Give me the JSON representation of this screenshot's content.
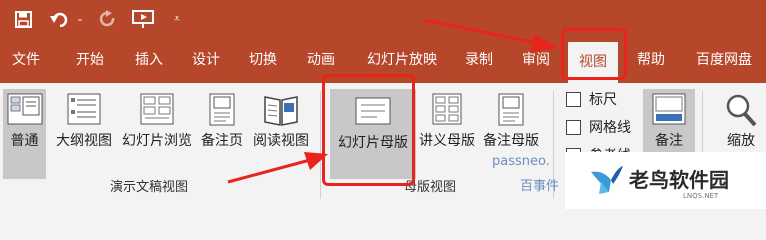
{
  "tabs": [
    "文件",
    "开始",
    "插入",
    "设计",
    "切换",
    "动画",
    "幻灯片放映",
    "录制",
    "审阅",
    "视图",
    "帮助",
    "百度网盘"
  ],
  "active_tab": "视图",
  "ribbon": {
    "presentation_views": [
      "普通",
      "大纲视图",
      "幻灯片浏览",
      "备注页",
      "阅读视图"
    ],
    "presentation_views_group": "演示文稿视图",
    "master_views": [
      "幻灯片母版",
      "讲义母版",
      "备注母版"
    ],
    "master_views_group": "母版视图",
    "show_options": [
      "标尺",
      "网格线",
      "参考线"
    ],
    "notes_label": "备注",
    "zoom_label": "缩放"
  },
  "watermark": {
    "line1": "passneo.",
    "line2": "百事件"
  },
  "logo": {
    "text": "老鸟软件园",
    "sub": "LNQS.NET"
  },
  "colors": {
    "accent": "#b7472a",
    "highlight": "#e8241c"
  }
}
